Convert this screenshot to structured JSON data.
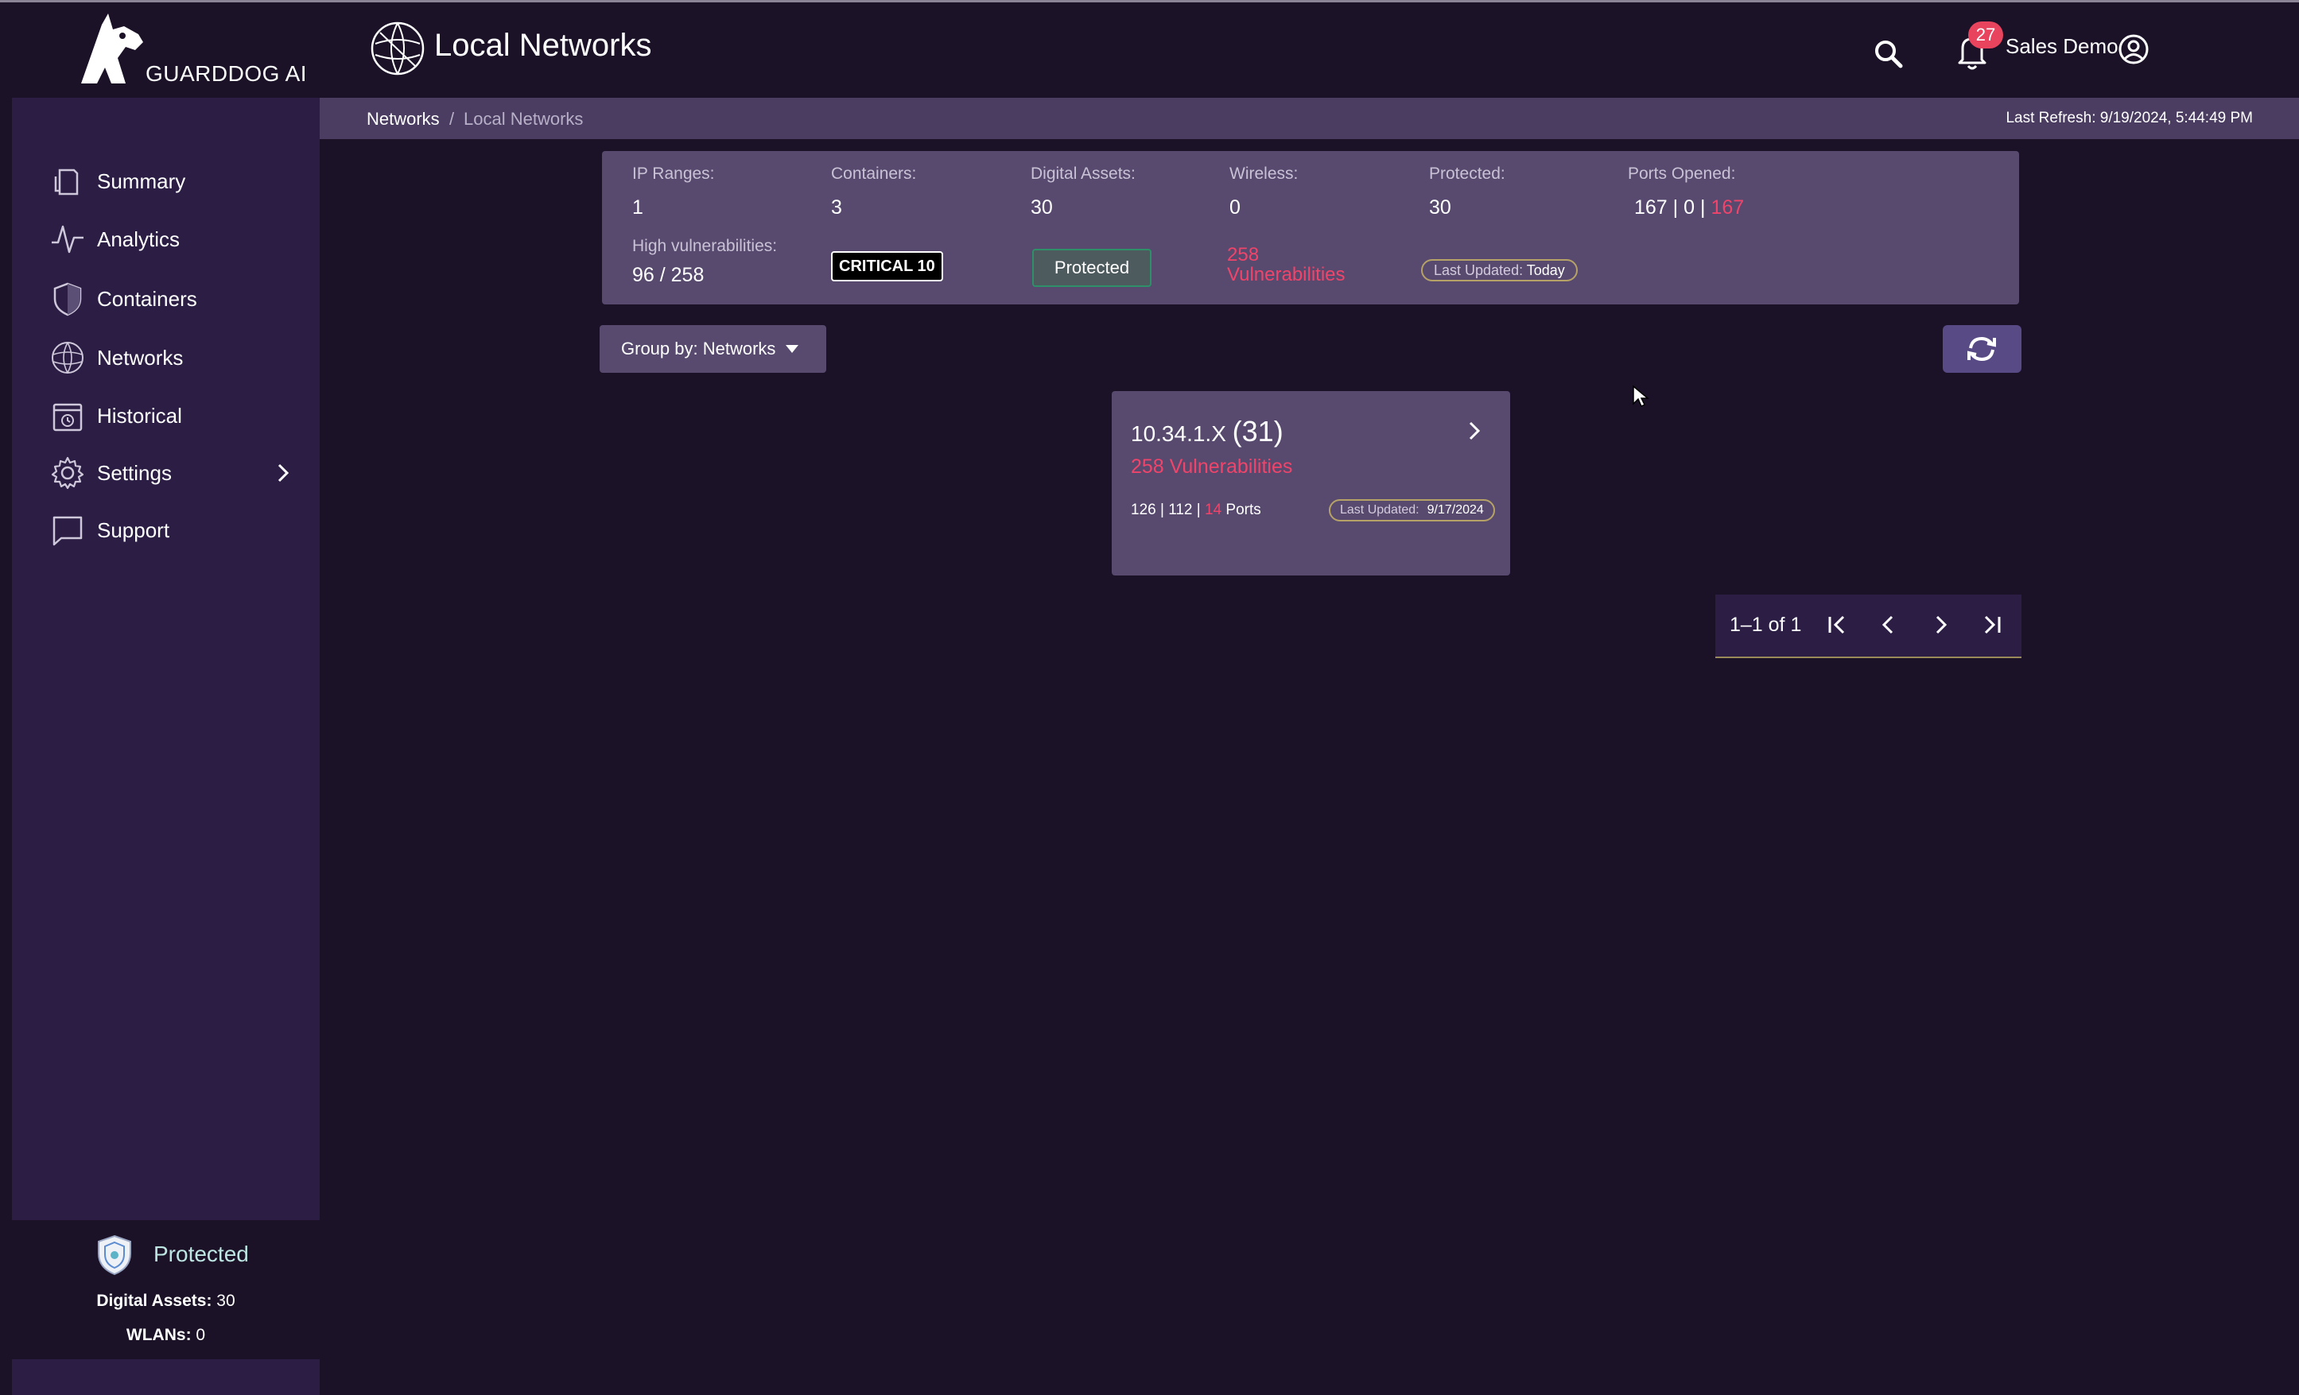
{
  "app": {
    "logo_text": "GUARDDOG AI",
    "page_title": "Local Networks"
  },
  "header": {
    "notification_count": "27",
    "user_name": "Sales Demo"
  },
  "sidebar": {
    "items": [
      {
        "label": "Summary",
        "icon": "document-icon"
      },
      {
        "label": "Analytics",
        "icon": "pulse-icon"
      },
      {
        "label": "Containers",
        "icon": "shield-icon"
      },
      {
        "label": "Networks",
        "icon": "globe-icon"
      },
      {
        "label": "Historical",
        "icon": "calendar-clock-icon"
      },
      {
        "label": "Settings",
        "icon": "gear-icon"
      },
      {
        "label": "Support",
        "icon": "chat-icon"
      }
    ],
    "footer": {
      "status": "Protected",
      "digital_assets_label": "Digital Assets:",
      "digital_assets_value": "30",
      "wlans_label": "WLANs:",
      "wlans_value": "0"
    }
  },
  "breadcrumb": {
    "parent": "Networks",
    "separator": "/",
    "current": "Local Networks",
    "last_refresh": "Last Refresh: 9/19/2024, 5:44:49 PM"
  },
  "stats": {
    "ip_ranges_label": "IP Ranges:",
    "ip_ranges_value": "1",
    "containers_label": "Containers:",
    "containers_value": "3",
    "digital_assets_label": "Digital Assets:",
    "digital_assets_value": "30",
    "wireless_label": "Wireless:",
    "wireless_value": "0",
    "protected_label": "Protected:",
    "protected_value": "30",
    "ports_label": "Ports Opened:",
    "ports_a": "167",
    "ports_sep1": "|",
    "ports_b": "0",
    "ports_sep2": "|",
    "ports_c": "167",
    "high_vuln_label": "High vulnerabilities:",
    "high_vuln_value": "96 / 258",
    "critical_chip": "CRITICAL 10",
    "protected_chip": "Protected",
    "vuln_count": "258",
    "vuln_word": "Vulnerabilities",
    "updated_label": "Last Updated:",
    "updated_value": "Today"
  },
  "toolbar": {
    "group_by_label": "Group by: Networks"
  },
  "network_card": {
    "name": "10.34.1.X",
    "count": "(31)",
    "vulnerabilities": "258 Vulnerabilities",
    "ports_a": "126",
    "ports_b": "112",
    "ports_c": "14",
    "ports_word": "Ports",
    "updated_label": "Last Updated:",
    "updated_value": "9/17/2024"
  },
  "pagination": {
    "range_text": "1–1 of 1"
  },
  "colors": {
    "background": "#1c1228",
    "sidebar": "#2b1d44",
    "card": "#574a6e",
    "accent_red": "#f0446a",
    "protected_green": "#2d9068"
  }
}
